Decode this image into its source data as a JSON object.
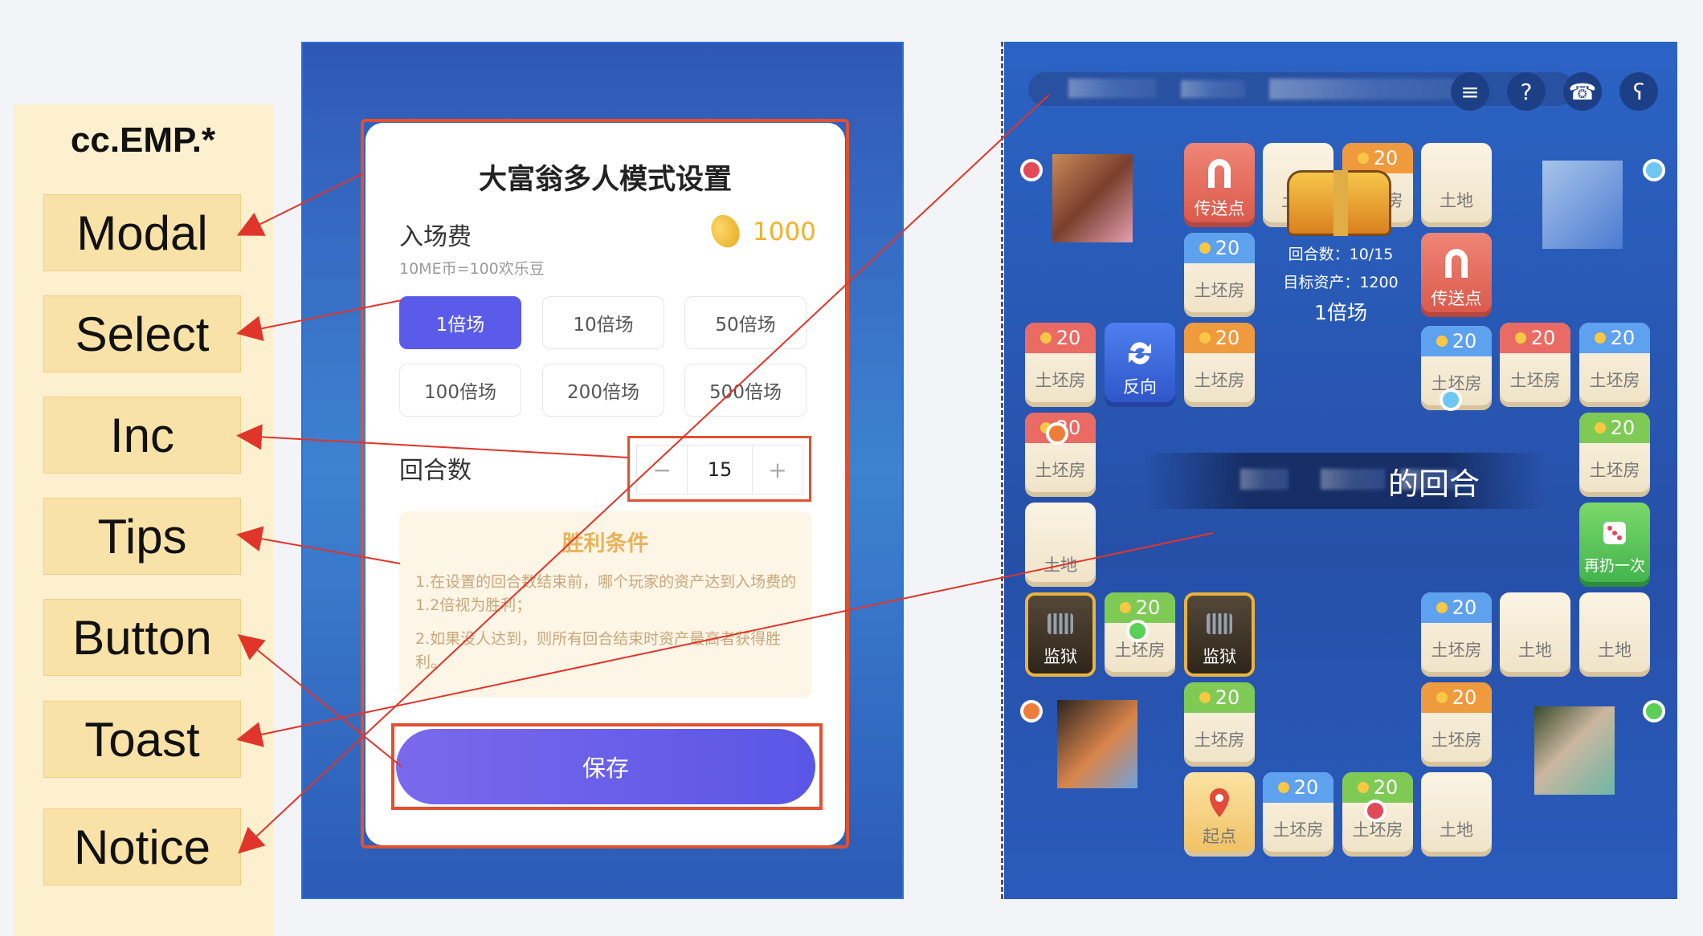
{
  "labels": {
    "title": "cc.EMP.*",
    "items": [
      "Modal",
      "Select",
      "Inc",
      "Tips",
      "Button",
      "Toast",
      "Notice"
    ]
  },
  "modal": {
    "title": "大富翁多人模式设置",
    "fee_label": "入场费",
    "fee_sub": "10ME币=100欢乐豆",
    "fee_value": "1000",
    "options": [
      "1倍场",
      "10倍场",
      "50倍场",
      "100倍场",
      "200倍场",
      "500倍场"
    ],
    "selected_option": "1倍场",
    "rounds_label": "回合数",
    "stepper": {
      "minus": "−",
      "value": "15",
      "plus": "+"
    },
    "tips": {
      "title": "胜利条件",
      "line1": "1.在设置的回合数结束前，哪个玩家的资产达到入场费的1.2倍视为胜利；",
      "line2": "2.如果没人达到，则所有回合结束时资产最高者获得胜利。"
    },
    "save_label": "保存"
  },
  "game": {
    "icons": {
      "menu": "≡",
      "help": "?",
      "phone": "☎",
      "bear": "ʕ"
    },
    "price": "20",
    "tile_land": "土地",
    "tile_house": "土坯房",
    "teleport": "传送点",
    "reverse": "反向",
    "jail": "监狱",
    "start": "起点",
    "reroll": "再扔一次",
    "center": {
      "rounds": "回合数：10/15",
      "target": "目标资产：1200",
      "mode": "1倍场"
    },
    "toast": "的回合"
  },
  "colors": {
    "accent": "#5b5be9",
    "highlight": "#e0512f",
    "coin": "#f2b12d",
    "label_bg": "#fdf0cf"
  }
}
